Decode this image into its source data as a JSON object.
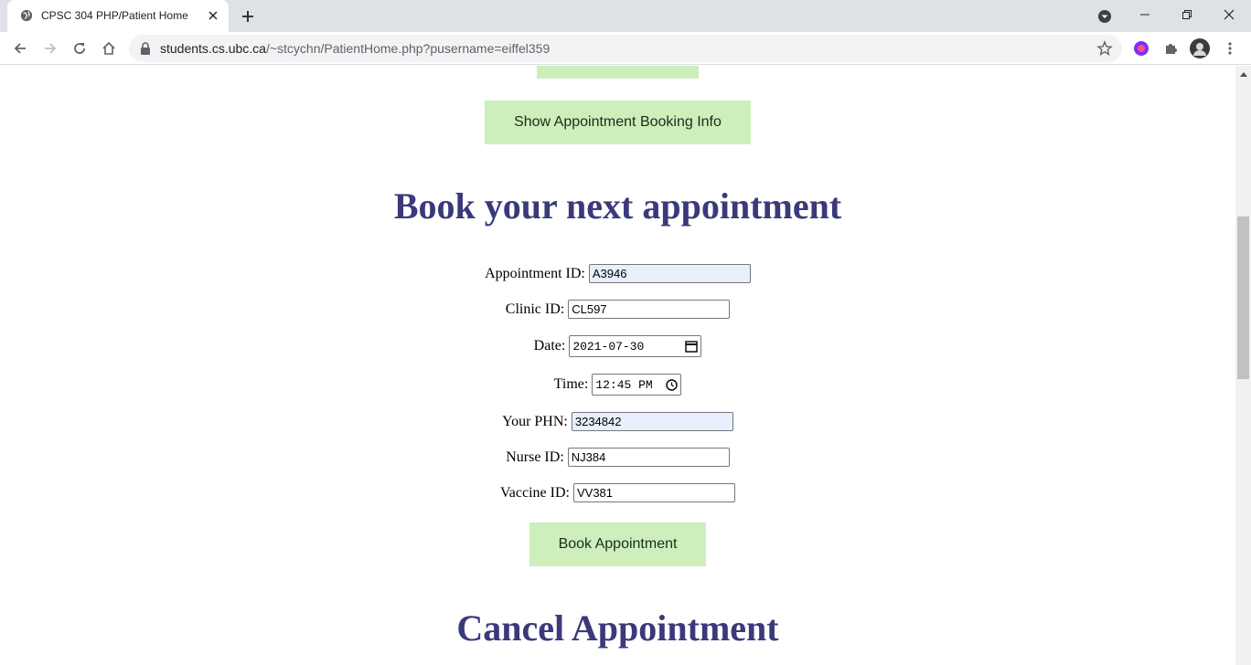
{
  "browser": {
    "tab_title": "CPSC 304 PHP/Patient Home",
    "url_host": "students.cs.ubc.ca",
    "url_path": "/~stcychn/PatientHome.php?pusername=eiffel359"
  },
  "page": {
    "show_booking_label": "Show Appointment Booking Info",
    "book_heading": "Book your next appointment",
    "cancel_heading": "Cancel Appointment",
    "book_button_label": "Book Appointment",
    "form": {
      "appointment_id_label": "Appointment ID:",
      "appointment_id_value": "A3946",
      "clinic_id_label": "Clinic ID:",
      "clinic_id_value": "CL597",
      "date_label": "Date:",
      "date_value": "2021-07-30",
      "time_label": "Time:",
      "time_value": "12:45 PM",
      "phn_label": "Your PHN:",
      "phn_value": "3234842",
      "nurse_id_label": "Nurse ID:",
      "nurse_id_value": "NJ384",
      "vaccine_id_label": "Vaccine ID:",
      "vaccine_id_value": "VV381"
    }
  },
  "colors": {
    "button_bg": "#ccefbc",
    "heading": "#3a3a7a",
    "autofill_bg": "#e8f0fe"
  }
}
